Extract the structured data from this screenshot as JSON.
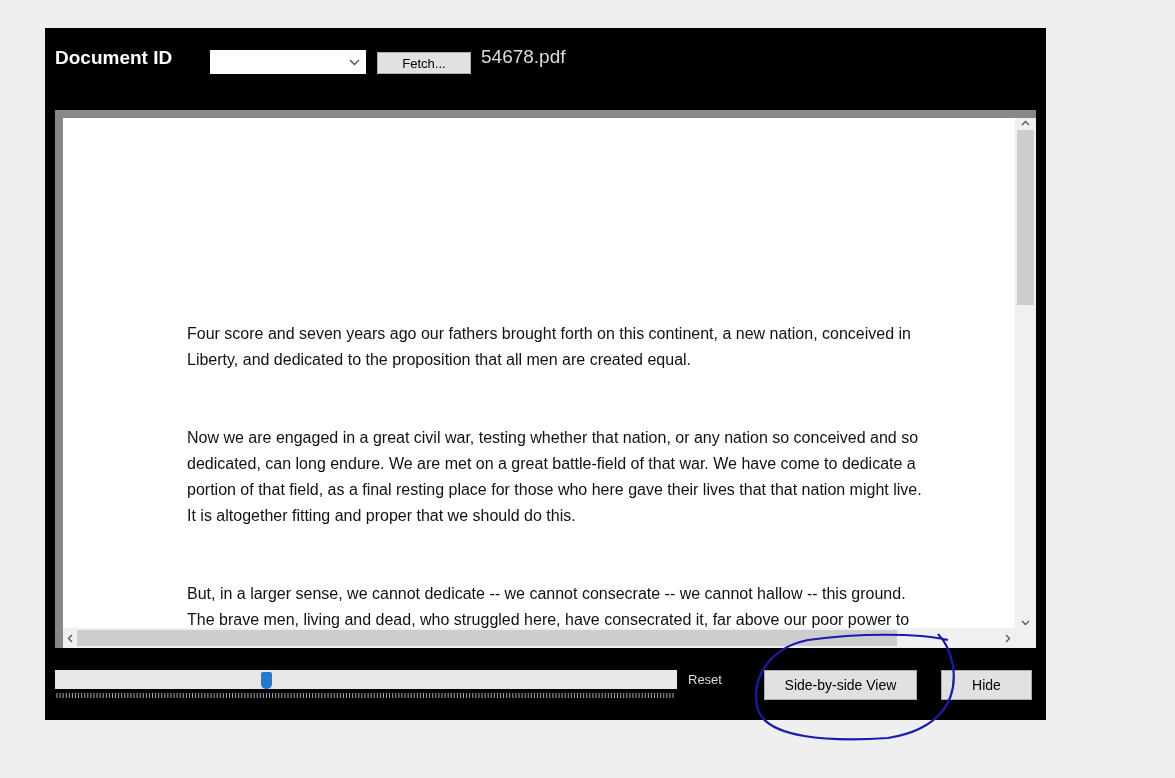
{
  "toolbar": {
    "label": "Document ID",
    "fetch_button": "Fetch...",
    "file_name": "54678.pdf"
  },
  "document": {
    "paragraphs": [
      "Four score and seven years ago our fathers brought forth on this continent, a new nation, conceived in Liberty, and dedicated to the proposition that all men are created equal.",
      "Now we are engaged in a great civil war, testing whether that nation, or any nation so conceived and so dedicated, can long endure. We are met on a great battle-field of that war. We have come to dedicate a portion of that field, as a final resting place for those who here gave their lives that that nation might live. It is altogether fitting and proper that we should do this.",
      "But, in a larger sense, we cannot dedicate -- we cannot consecrate -- we cannot hallow -- this ground. The brave men, living and dead, who struggled here, have consecrated it, far above our poor power to"
    ]
  },
  "zoom": {
    "level": 0.34,
    "reset": "Reset"
  },
  "buttons": [
    {
      "label": "Side-by-side View",
      "kind": "wide"
    },
    {
      "label": "Hide",
      "kind": "narrow"
    }
  ]
}
